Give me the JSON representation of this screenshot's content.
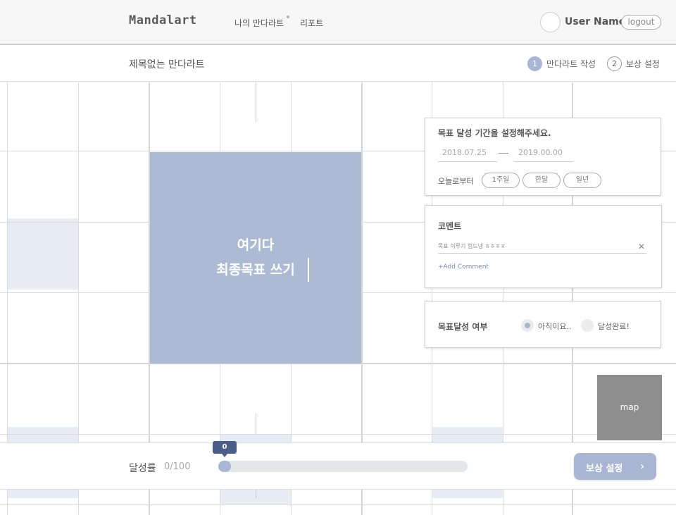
{
  "header": {
    "logo": "Mandalart",
    "nav": [
      {
        "label": "나의 만다라트"
      },
      {
        "label": "리포트"
      }
    ],
    "user_name": "User Name",
    "logout_label": "logout"
  },
  "subheader": {
    "title": "제목없는 만다라트",
    "steps": [
      {
        "num": "1",
        "label": "만다라트 작성",
        "active": true
      },
      {
        "num": "2",
        "label": "보상 설정",
        "active": false
      }
    ]
  },
  "center_goal": {
    "line1": "여기다",
    "line2": "최종목표 쓰기"
  },
  "period_panel": {
    "title": "목표 달성 기간을 설정해주세요.",
    "start_date": "2018.07.25",
    "end_date": "2019.00.00",
    "from_today_label": "오늘로부터",
    "options": [
      "1주일",
      "한달",
      "일년"
    ]
  },
  "comment_panel": {
    "title": "코멘트",
    "comment_text": "목표 이루기 힘드넹 ㅎㅎㅎㅎ",
    "add_label": "+Add Comment"
  },
  "status_panel": {
    "title": "목표달성 여부",
    "options": [
      {
        "label": "아직이요..",
        "selected": true
      },
      {
        "label": "달성완료!",
        "selected": false
      }
    ]
  },
  "map_label": "map",
  "progress": {
    "label": "달성률",
    "value_text": "0/100",
    "bubble": "0",
    "value": 0,
    "max": 100
  },
  "next_button": {
    "label": "보상 설정",
    "arrow": "›"
  },
  "colors": {
    "accent": "#a9b6d3",
    "center_cell": "#adbad4",
    "bubble": "#4a5e8a",
    "map": "#8e8e8e"
  }
}
